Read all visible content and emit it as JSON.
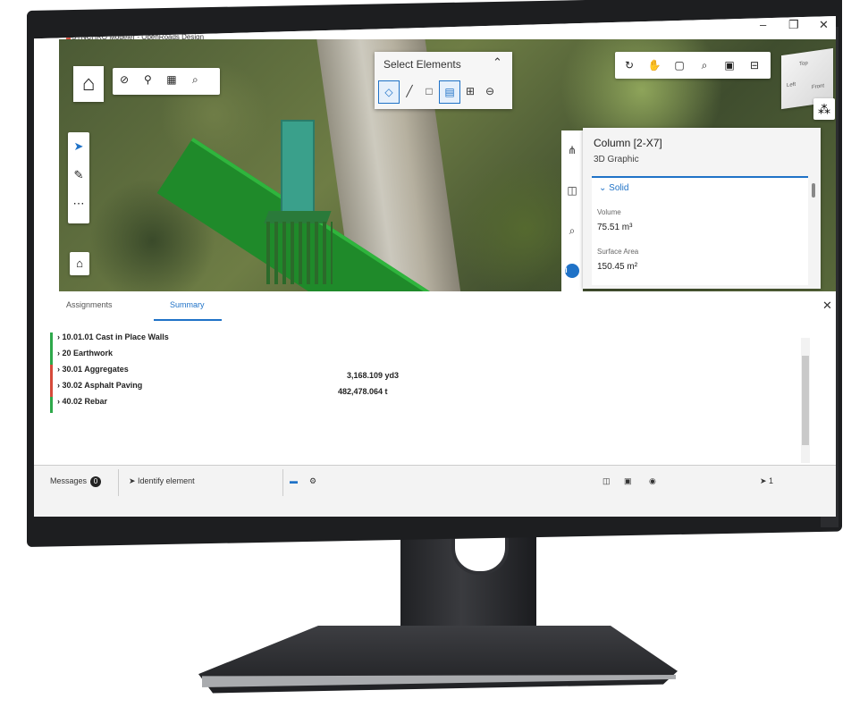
{
  "window": {
    "title": "SYNCHRO Modeler - OpenRoads Design",
    "controls": [
      "–",
      "❐",
      "✕"
    ]
  },
  "viewport": {
    "select_panel": {
      "title": "Select Elements",
      "tools": [
        "selection-target-icon",
        "line-icon",
        "box-icon",
        "select-filter-icon",
        "add-icon",
        "remove-icon"
      ]
    },
    "left_toolbar": [
      "cursor-icon",
      "pencil-icon",
      "more-icon"
    ],
    "right_toolbar": [
      "rotate-icon",
      "pan-icon",
      "fit-icon",
      "zoom-icon",
      "section-icon",
      "camera-icon"
    ],
    "view_cube_faces": [
      "Top",
      "Left",
      "Front"
    ]
  },
  "properties": {
    "title": "Column [2-X7]",
    "subtitle": "3D Graphic",
    "section": "Solid",
    "volume_label": "Volume",
    "volume_value": "75.51 m³",
    "surface_label": "Surface Area",
    "surface_value": "150.45 m²"
  },
  "bottom_panel": {
    "tabs": [
      "Assignments",
      "Summary"
    ],
    "active_tab": "Summary",
    "rows": [
      {
        "label": "10.01.01 Cast in Place Walls",
        "quantity": "",
        "color": "#2ea84a"
      },
      {
        "label": "20 Earthwork",
        "quantity": "",
        "color": "#2ea84a"
      },
      {
        "label": "30.01 Aggregates",
        "quantity": "3,168.109  yd3",
        "color": "#d64a3a"
      },
      {
        "label": "30.02 Asphalt Paving",
        "quantity": "482,478.064  t",
        "color": "#d64a3a"
      },
      {
        "label": "40.02 Rebar",
        "quantity": "",
        "color": "#2ea84a"
      }
    ]
  },
  "statusbar": {
    "messages_label": "Messages",
    "messages_count": "0",
    "identify_label": "Identify element",
    "selection_count": "1"
  },
  "colors": {
    "accent": "#1f72c7",
    "beam": "#1f8a2a"
  }
}
